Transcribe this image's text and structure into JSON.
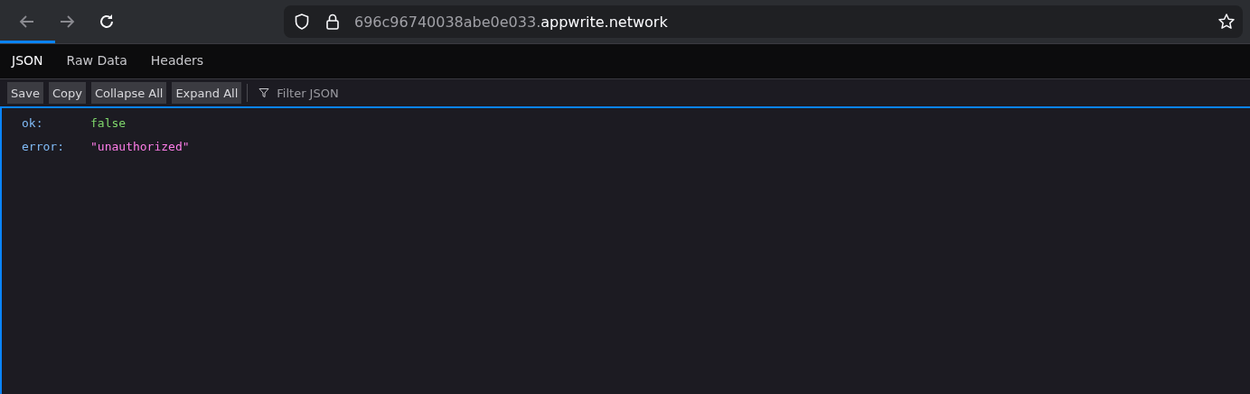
{
  "address_bar": {
    "host_prefix": "696c96740038abe0e033.",
    "domain": "appwrite.network"
  },
  "tabs": [
    {
      "label": "JSON",
      "selected": true
    },
    {
      "label": "Raw Data",
      "selected": false
    },
    {
      "label": "Headers",
      "selected": false
    }
  ],
  "toolbar": {
    "buttons": [
      "Save",
      "Copy",
      "Collapse All",
      "Expand All"
    ],
    "filter": {
      "placeholder": "Filter JSON"
    }
  },
  "json_rows": [
    {
      "key": "ok:",
      "value": "false",
      "kind": "boolean"
    },
    {
      "key": "error:",
      "value": "\"unauthorized\"",
      "kind": "string"
    }
  ]
}
